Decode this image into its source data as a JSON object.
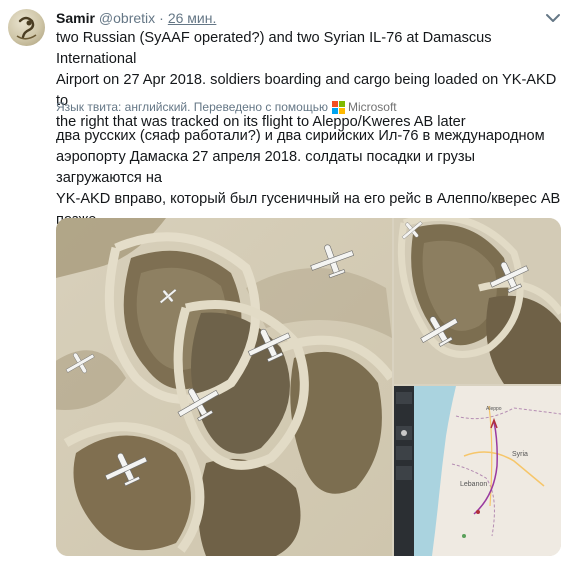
{
  "tweet": {
    "author_name": "Samir",
    "author_handle": "@obretix",
    "separator": "·",
    "timestamp": "26 мин.",
    "text": "two Russian (SyAAF operated?) and two Syrian IL-76 at Damascus International\nAirport on 27 Apr 2018. soldiers boarding and cargo being loaded on YK-AKD to\nthe right that was tracked on its flight to Aleppo/Kweres AB later",
    "translation_label": "Язык твита: английский. Переведено с помощью",
    "translation_provider": "Microsoft",
    "translated_text": "два русских (сяаф работали?) и два сирийских Ил-76 в международном\nаэропорту Дамаска 27 апреля 2018. солдаты посадки и грузы загружаются на\nYK-AKD вправо, который был гусеничный на его рейс в Алеппо/кверес АВ\nпозже"
  },
  "map": {
    "place_labels": [
      "Lebanon",
      "Syria",
      "Aleppo"
    ]
  },
  "colors": {
    "text": "#14171a",
    "secondary": "#657786",
    "accent": "#1da1f2",
    "ms_red": "#f25022",
    "ms_green": "#7fba00",
    "ms_blue": "#00a4ef",
    "ms_yellow": "#ffb900"
  },
  "icons": [
    "avatar-image",
    "chevron-down-icon",
    "microsoft-logo-icon"
  ]
}
